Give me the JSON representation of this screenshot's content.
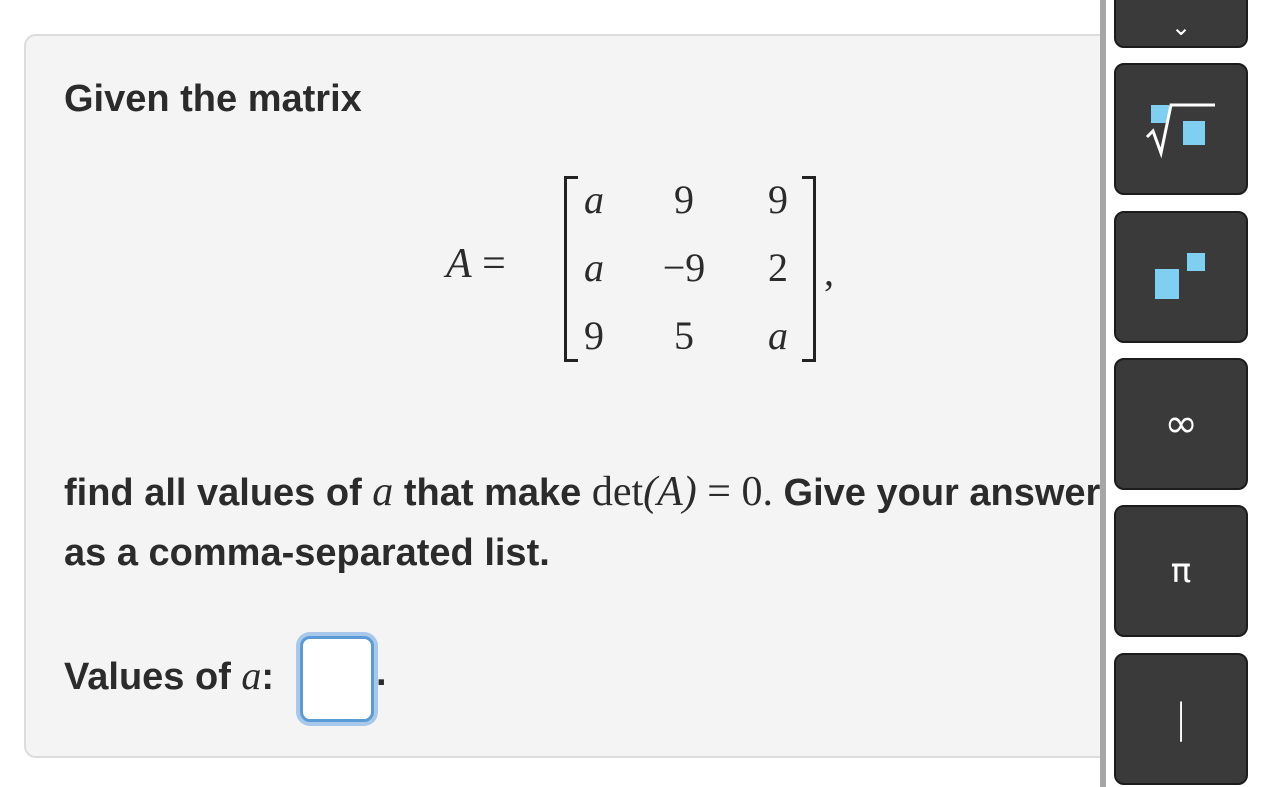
{
  "question": {
    "intro": "Given the matrix",
    "matrix_lhs": "A =",
    "matrix": [
      [
        "a",
        "9",
        "9"
      ],
      [
        "a",
        "−9",
        "2"
      ],
      [
        "9",
        "5",
        "a"
      ]
    ],
    "matrix_trailing": ",",
    "prompt_part1": "find all values of ",
    "prompt_var": "a",
    "prompt_part2": " that make ",
    "prompt_det": "det",
    "prompt_det_arg": "(A)",
    "prompt_eq": " = 0.",
    "prompt_part3": " Give your answer as a comma-separated list."
  },
  "answer": {
    "label_prefix": "Values of ",
    "label_var": "a",
    "label_suffix": ":",
    "value": "",
    "trailing": "."
  },
  "keypad": {
    "keys": [
      {
        "name": "top-partial-key"
      },
      {
        "name": "sqrt-key"
      },
      {
        "name": "exponent-key"
      },
      {
        "name": "infinity-key",
        "label": "∞"
      },
      {
        "name": "pi-key",
        "label": "π"
      },
      {
        "name": "absolute-value-key",
        "label": "|"
      }
    ],
    "accent_color": "#7fd0f0"
  }
}
